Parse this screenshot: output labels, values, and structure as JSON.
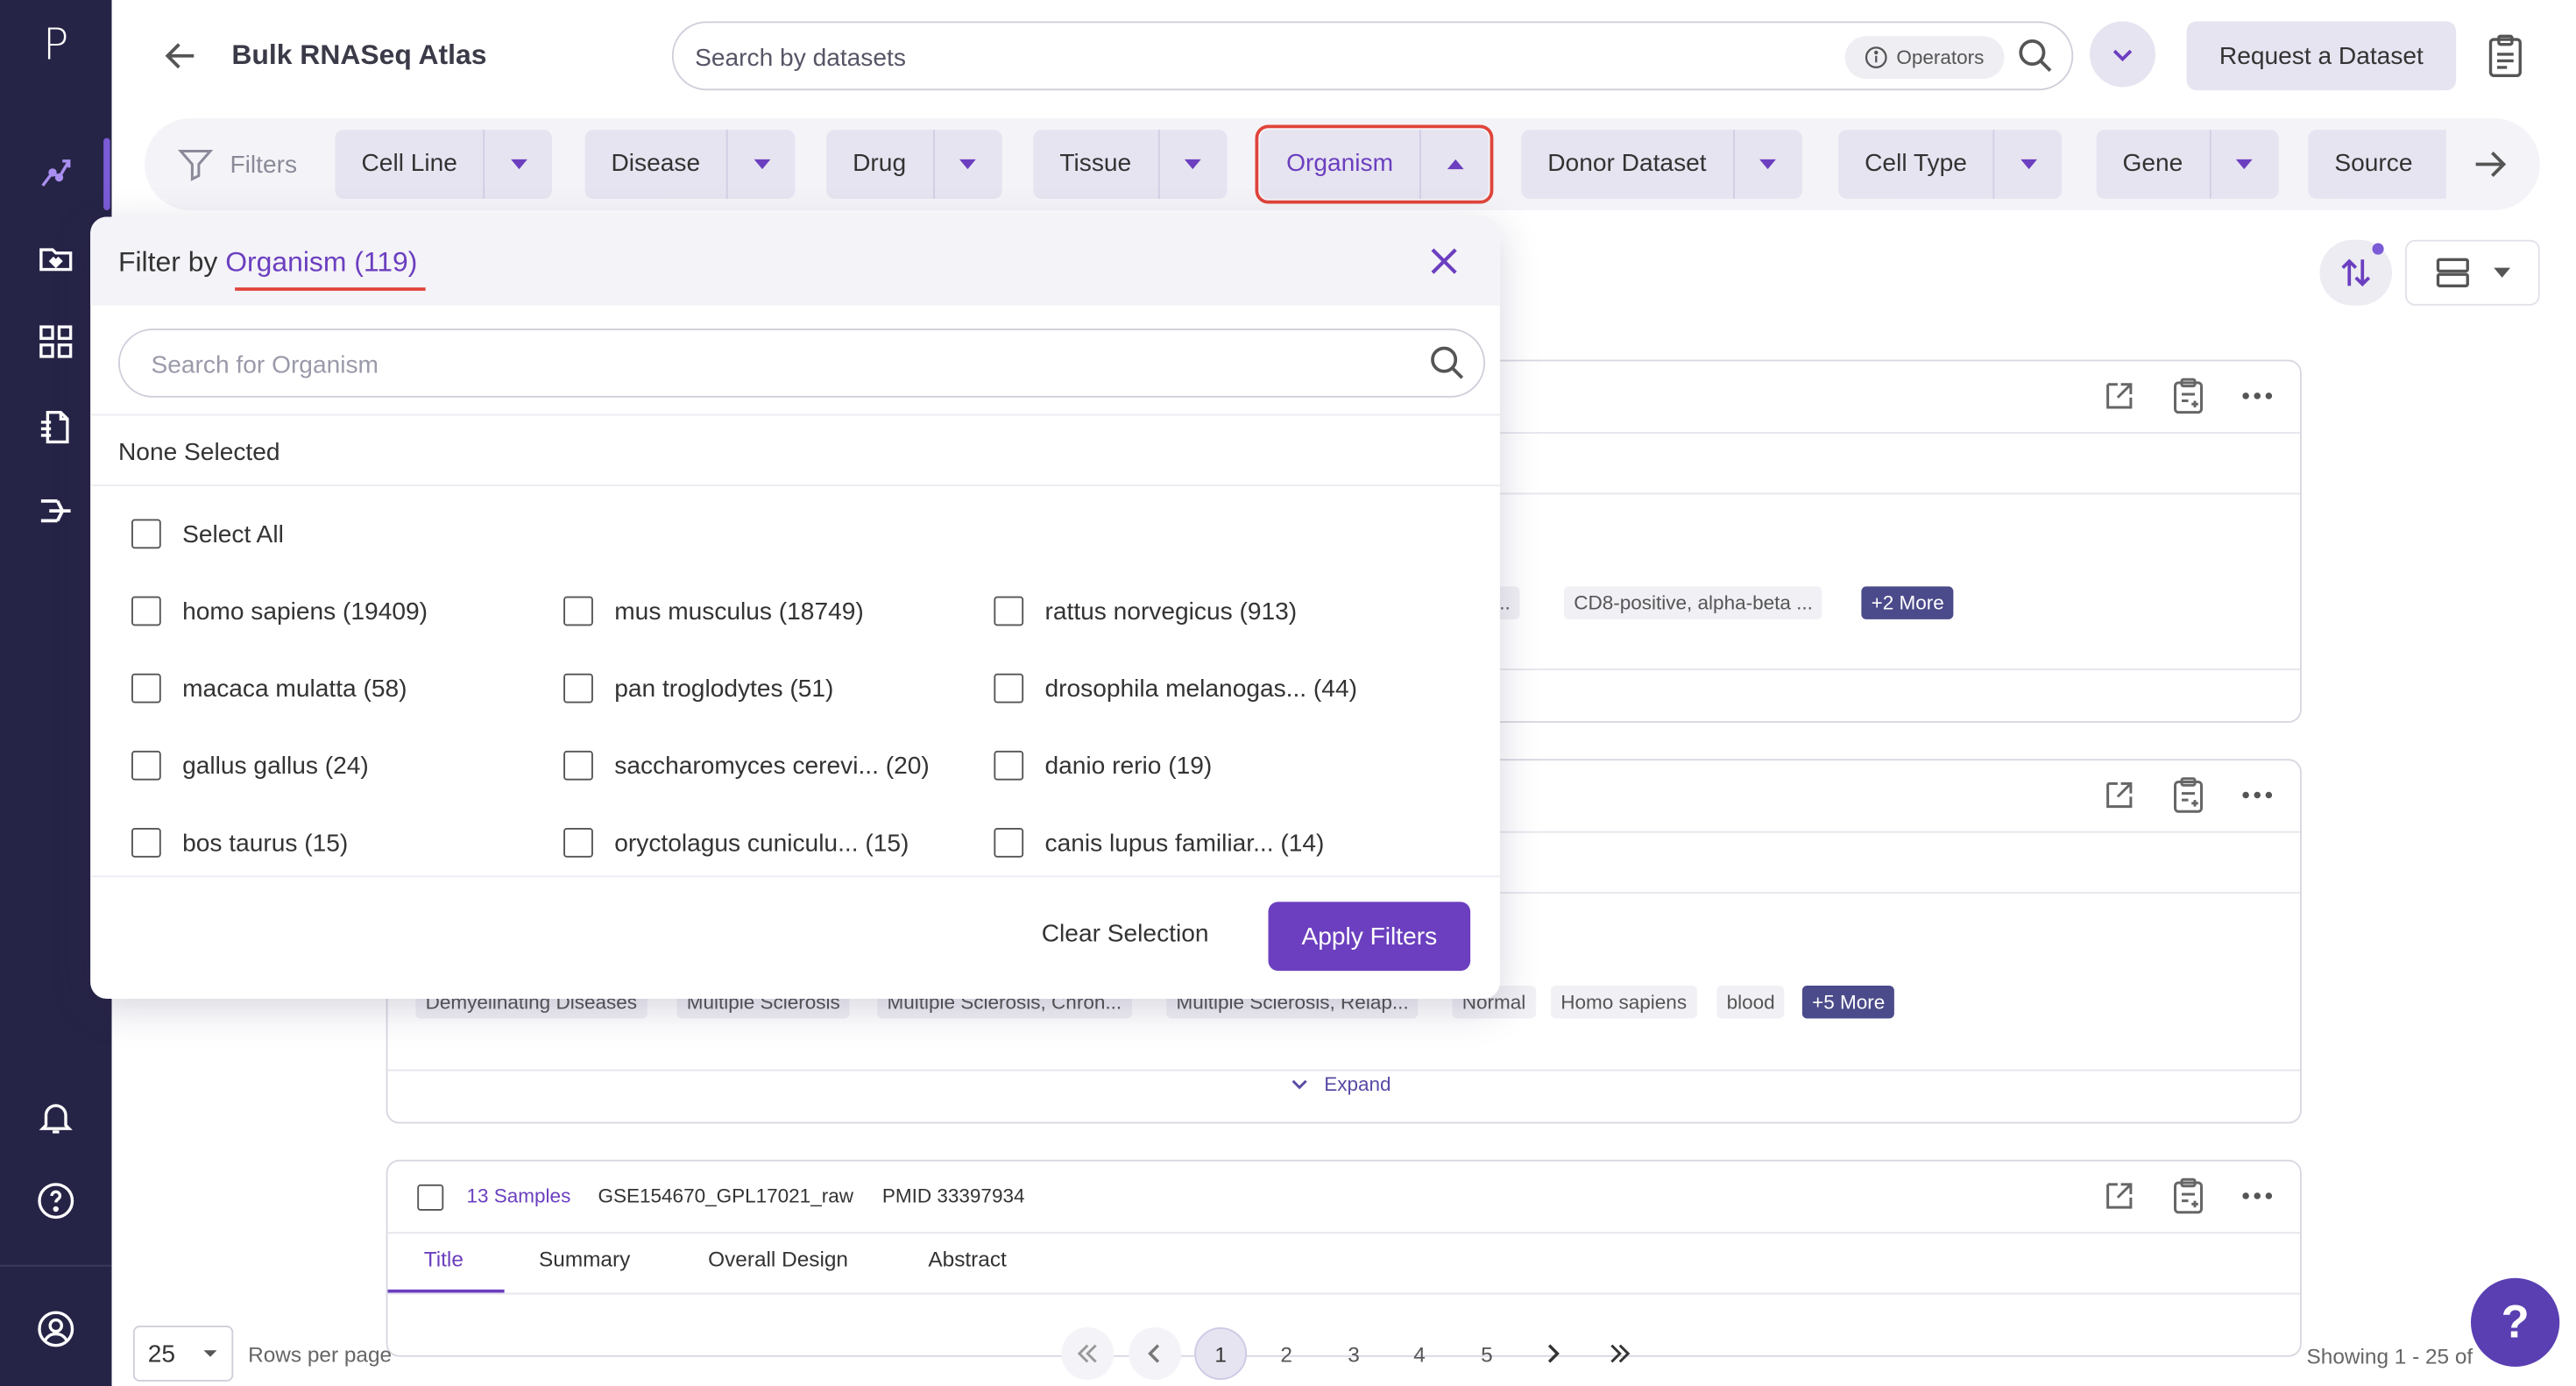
{
  "app": {
    "logo": "P",
    "page_title": "Bulk RNASeq Atlas"
  },
  "header": {
    "search_placeholder": "Search by datasets",
    "operators_label": "Operators",
    "request_button": "Request a Dataset"
  },
  "filter_bar": {
    "label": "Filters",
    "chips": [
      "Cell Line",
      "Disease",
      "Drug",
      "Tissue",
      "Organism",
      "Donor Dataset",
      "Cell Type",
      "Gene",
      "Source"
    ],
    "active_chip": "Organism"
  },
  "filter_popover": {
    "title_prefix": "Filter by",
    "title_field": "Organism",
    "title_count": "(119)",
    "search_placeholder": "Search for Organism",
    "selection_status": "None Selected",
    "select_all": "Select All",
    "options": [
      "homo sapiens (19409)",
      "mus musculus (18749)",
      "rattus norvegicus (913)",
      "macaca mulatta (58)",
      "pan troglodytes (51)",
      "drosophila melanogas... (44)",
      "gallus gallus (24)",
      "saccharomyces cerevi... (20)",
      "danio rerio (19)",
      "bos taurus (15)",
      "oryctolagus cuniculu... (15)",
      "canis lupus familiar... (14)"
    ],
    "clear_button": "Clear Selection",
    "apply_button": "Apply Filters"
  },
  "cards": {
    "card1_tags": [
      "cel...",
      "CD8-positive, alpha-beta ...",
      "+2 More"
    ],
    "card2_tags": [
      "Demyelinating Diseases",
      "Multiple Sclerosis",
      "Multiple Sclerosis, Chron...",
      "Multiple Sclerosis, Relap...",
      "Normal",
      "Homo sapiens",
      "blood",
      "+5 More"
    ],
    "card2_expand": "Expand",
    "card3": {
      "samples": "13 Samples",
      "dataset_id": "GSE154670_GPL17021_raw",
      "pmid": "PMID 33397934",
      "tabs": [
        "Title",
        "Summary",
        "Overall Design",
        "Abstract"
      ],
      "active_tab": "Title"
    }
  },
  "pagination": {
    "rows_per_page_value": "25",
    "rows_per_page_label": "Rows per page",
    "pages": [
      "1",
      "2",
      "3",
      "4",
      "5"
    ],
    "current_page": "1",
    "showing_text": "Showing 1 - 25 of"
  },
  "help_fab": "?",
  "colors": {
    "sidebar_bg": "#262446",
    "accent": "#6b3fbf",
    "chip_bg": "#e7e4f1",
    "highlight_outline": "#e0443a"
  }
}
